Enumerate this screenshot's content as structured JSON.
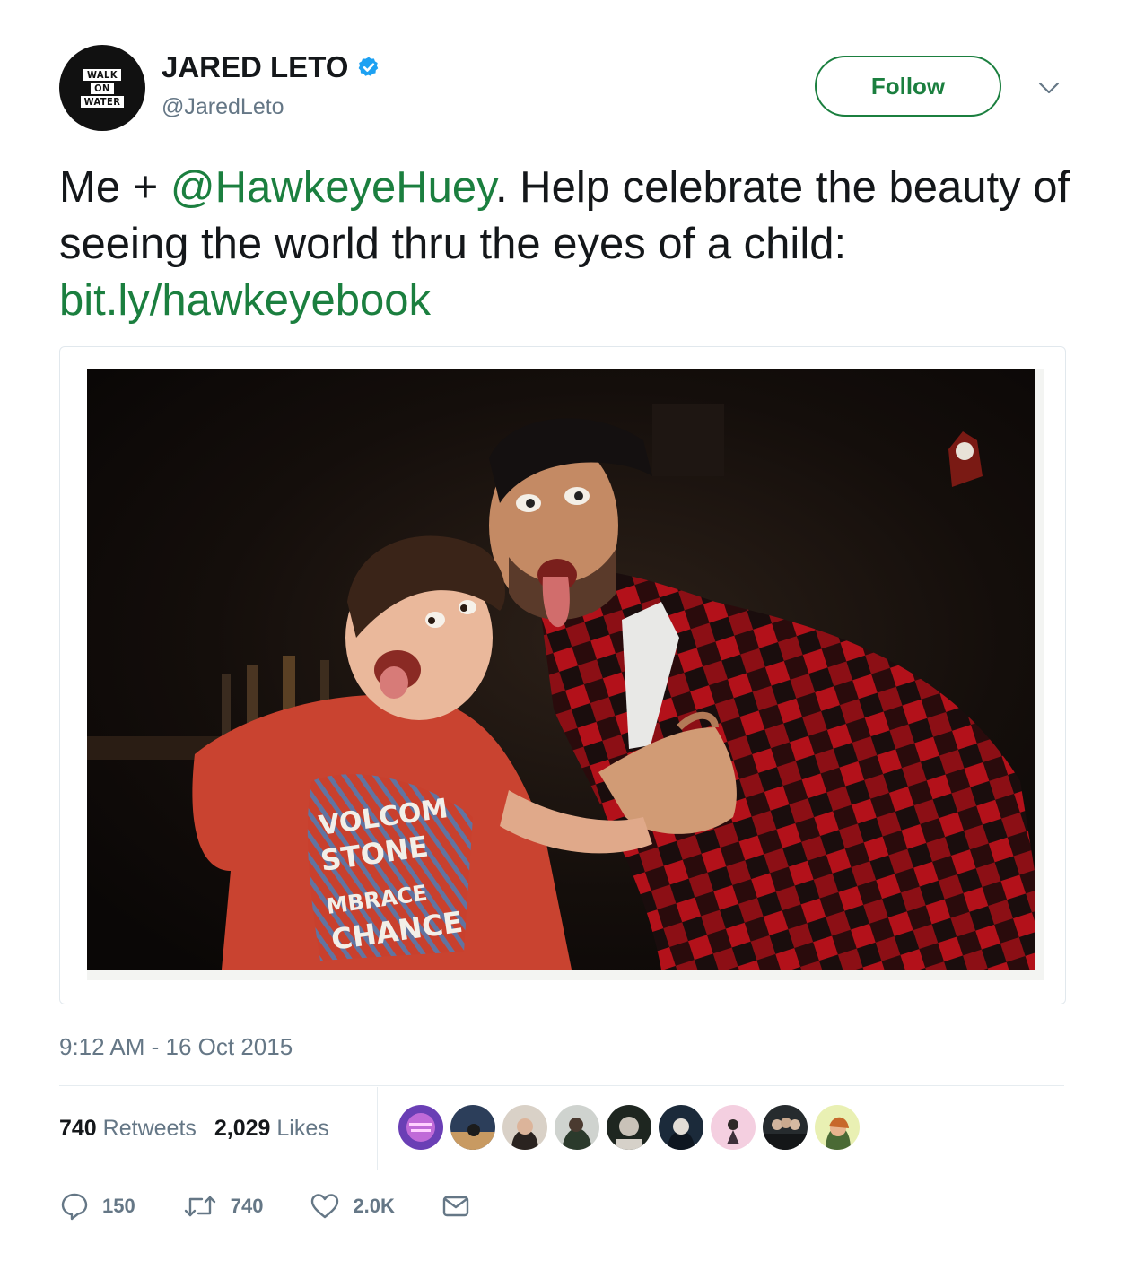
{
  "author": {
    "avatar_lines": [
      "WALK",
      "ON",
      "WATER"
    ],
    "display_name": "JARED LETO",
    "handle": "@JaredLeto",
    "verified_icon": "verified-badge-icon"
  },
  "header": {
    "follow_label": "Follow",
    "menu_icon": "chevron-down-icon"
  },
  "tweet": {
    "text_before": "Me + ",
    "mention": "@HawkeyeHuey",
    "text_middle": ". Help celebrate the beauty of seeing the world thru the eyes of a child: ",
    "link": "bit.ly/hawkeyebook",
    "photo_shirt_text": [
      "VOLCOM",
      "STONE",
      "MBRACE",
      "CHANCE"
    ]
  },
  "timestamp": "9:12 AM - 16 Oct 2015",
  "stats": {
    "retweets_count": "740",
    "retweets_label": "Retweets",
    "likes_count": "2,029",
    "likes_label": "Likes",
    "likers_count": 9
  },
  "actions": {
    "reply_count": "150",
    "retweet_count": "740",
    "like_count": "2.0K",
    "reply_icon": "reply-icon",
    "retweet_icon": "retweet-icon",
    "like_icon": "heart-icon",
    "dm_icon": "envelope-icon"
  },
  "colors": {
    "link": "#1b7f3f",
    "verified": "#1da1f2",
    "muted": "#657786",
    "text": "#14171a"
  }
}
